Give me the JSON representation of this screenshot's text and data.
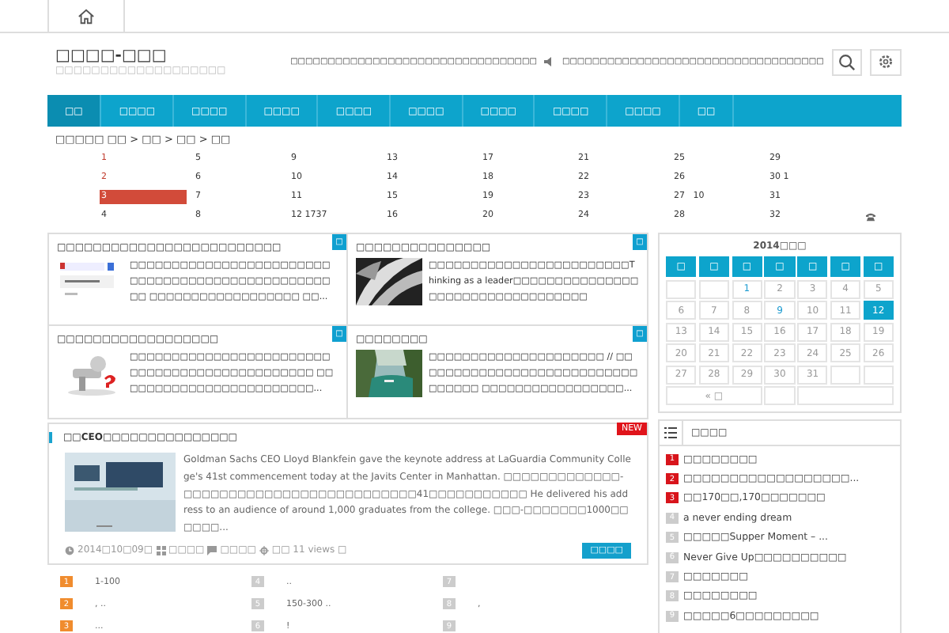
{
  "site": {
    "title": "□□□□-□□□",
    "subtitle": "□□□□□□□□□□□□□□□□□□□"
  },
  "ticker": [
    "□□□□□□□□□□□□□□□□□□□□□□□□□□□□□□□□□",
    "□□□□□□□□□□□□□□□□□□□□□□□□□□□□□□□□□□□"
  ],
  "nav": [
    {
      "label": "□□",
      "selected": true
    },
    {
      "label": "□□□□",
      "selected": false
    },
    {
      "label": "□□□□",
      "selected": false
    },
    {
      "label": "□□□□",
      "selected": false
    },
    {
      "label": "□□□□",
      "selected": false
    },
    {
      "label": "□□□□",
      "selected": false
    },
    {
      "label": "□□□□",
      "selected": false
    },
    {
      "label": "□□□□",
      "selected": false
    },
    {
      "label": "□□□□",
      "selected": false
    },
    {
      "label": "□□",
      "selected": false
    }
  ],
  "breadcrumb": "□□□□□ □□ > □□ > □□ > □□",
  "number_grid": {
    "ranks": [
      {
        "text": "1",
        "hot": true,
        "selected": false
      },
      {
        "text": "2",
        "hot": true,
        "selected": false
      },
      {
        "text": "3",
        "hot": true,
        "selected": true
      },
      {
        "text": "4",
        "hot": false,
        "selected": false
      }
    ],
    "columns": [
      [
        "5",
        "6",
        "7",
        "8"
      ],
      [
        "9",
        "10",
        "11",
        "12 1737"
      ],
      [
        "13",
        "14",
        "15",
        "16"
      ],
      [
        "17",
        "18",
        "19",
        "20"
      ],
      [
        "21",
        "22",
        "23",
        "24"
      ],
      [
        "25",
        "26",
        "27   10",
        "28"
      ],
      [
        "29",
        "30 1",
        "31",
        "32"
      ]
    ]
  },
  "cards": [
    {
      "title": "□□□□□□□□□□□□□□□□□□□□□□□□□",
      "badge": "□",
      "excerpt": "□□□□□□□□□□□□□□□□□□□□□□□□□□□□□□□□□□□□□□□□□□□□□□□□□□ □□□□□□□□□□□□□□□□□□ □□..."
    },
    {
      "title": "□□□□□□□□□□□□□□□",
      "badge": "□",
      "excerpt": "□□□□□□□□□□□□□□□□□□□□□□□□Thinking as a leader□□□□□□□□□□□□□□□□□□□□□□□□□□□□□□□□□□"
    },
    {
      "title": "□□□□□□□□□□□□□□□□□□",
      "badge": "□",
      "excerpt": "□□□□□□□□□□□□□□□□□□□□□□□□□□□□□□□□□□□□□□□□□□□□□□ □□ □□□□□□□□□□□□□□□□□□□□□□..."
    },
    {
      "title": "□□□□□□□□",
      "badge": "□",
      "excerpt": "□□□□□□□□□□□□□□□□□□□□□ // □□□□□□□□□□□□□□□□□□□□□□□□□□□□□□□□□ □□□□□□□□□□□□□□□□□..."
    }
  ],
  "featured": {
    "title": "□□CEO□□□□□□□□□□□□□□□",
    "badge": "NEW",
    "text": "Goldman Sachs CEO Lloyd Blankfein gave the keynote address at LaGuardia Community College's 41st commencement today at the Javits Center in Manhattan. □□□□□□□□□□□□□-□□□□□□□□□□□□□□□□□□□□□□□□□□41□□□□□□□□□□□ He delivered his address to an audience of around 1,000 graduates from the college. □□□-□□□□□□□1000□□□□□□...",
    "date": "2014□10□09□",
    "category": "□□□□",
    "comments": "□□□□",
    "views": "□□ 11 views □",
    "button": "□□□□"
  },
  "bottom_list": [
    [
      {
        "num": "1",
        "top": true,
        "text": "1-100"
      },
      {
        "num": "2",
        "top": true,
        "text": ", .."
      },
      {
        "num": "3",
        "top": true,
        "text": "..."
      }
    ],
    [
      {
        "num": "4",
        "top": false,
        "text": ".."
      },
      {
        "num": "5",
        "top": false,
        "text": "150-300 .."
      },
      {
        "num": "6",
        "top": false,
        "text": "!"
      }
    ],
    [
      {
        "num": "7",
        "top": false
      },
      {
        "num": "8",
        "top": false,
        "text": ","
      },
      {
        "num": "9",
        "top": false
      }
    ]
  ],
  "calendar": {
    "title": "2014□□□",
    "weekdays": [
      "□",
      "□",
      "□",
      "□",
      "□",
      "□",
      "□"
    ],
    "weeks": [
      [
        {
          "selected": false
        },
        {
          "selected": false
        },
        {
          "day": "1",
          "linked": true,
          "selected": false
        },
        {
          "day": "2",
          "linked": false,
          "selected": false
        },
        {
          "day": "3",
          "linked": false,
          "selected": false
        },
        {
          "day": "4",
          "linked": false,
          "selected": false
        },
        {
          "day": "5",
          "linked": false,
          "selected": false
        }
      ],
      [
        {
          "day": "6",
          "linked": false,
          "selected": false
        },
        {
          "day": "7",
          "linked": false,
          "selected": false
        },
        {
          "day": "8",
          "linked": false,
          "selected": false
        },
        {
          "day": "9",
          "linked": true,
          "selected": false
        },
        {
          "day": "10",
          "linked": false,
          "selected": false
        },
        {
          "day": "11",
          "linked": false,
          "selected": false
        },
        {
          "day": "12",
          "linked": false,
          "selected": true
        }
      ],
      [
        {
          "day": "13",
          "linked": false,
          "selected": false
        },
        {
          "day": "14",
          "linked": false,
          "selected": false
        },
        {
          "day": "15",
          "linked": false,
          "selected": false
        },
        {
          "day": "16",
          "linked": false,
          "selected": false
        },
        {
          "day": "17",
          "linked": false,
          "selected": false
        },
        {
          "day": "18",
          "linked": false,
          "selected": false
        },
        {
          "day": "19",
          "linked": false,
          "selected": false
        }
      ],
      [
        {
          "day": "20",
          "linked": false,
          "selected": false
        },
        {
          "day": "21",
          "linked": false,
          "selected": false
        },
        {
          "day": "22",
          "linked": false,
          "selected": false
        },
        {
          "day": "23",
          "linked": false,
          "selected": false
        },
        {
          "day": "24",
          "linked": false,
          "selected": false
        },
        {
          "day": "25",
          "linked": false,
          "selected": false
        },
        {
          "day": "26",
          "linked": false,
          "selected": false
        }
      ],
      [
        {
          "day": "27",
          "linked": false,
          "selected": false
        },
        {
          "day": "28",
          "linked": false,
          "selected": false
        },
        {
          "day": "29",
          "linked": false,
          "selected": false
        },
        {
          "day": "30",
          "linked": false,
          "selected": false
        },
        {
          "day": "31",
          "linked": false,
          "selected": false
        },
        {
          "selected": false
        },
        {
          "selected": false
        }
      ]
    ],
    "prev": "« □"
  },
  "hot": {
    "title": "□□□□",
    "items": [
      {
        "num": "1",
        "top": true,
        "text": "□□□□□□□□"
      },
      {
        "num": "2",
        "top": true,
        "text": "□□□□□□□□□□□□□□□□□□..."
      },
      {
        "num": "3",
        "top": true,
        "text": "□□170□□,170□□□□□□□"
      },
      {
        "num": "4",
        "top": false,
        "text": "a never ending dream"
      },
      {
        "num": "5",
        "top": false,
        "text": "□□□□□Supper Moment – ..."
      },
      {
        "num": "6",
        "top": false,
        "text": "Never Give Up□□□□□□□□□□"
      },
      {
        "num": "7",
        "top": false,
        "text": "□□□□□□□"
      },
      {
        "num": "8",
        "top": false,
        "text": "□□□□□□□□"
      },
      {
        "num": "9",
        "top": false,
        "text": "□□□□□6□□□□□□□□□"
      }
    ]
  }
}
